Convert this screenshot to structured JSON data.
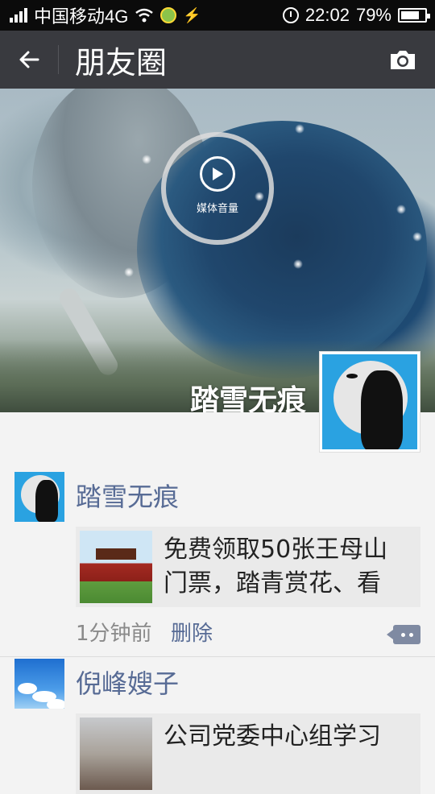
{
  "status_bar": {
    "carrier": "中国移动4G",
    "time": "22:02",
    "battery": "79%",
    "battery_level": 0.79
  },
  "header": {
    "title": "朋友圈"
  },
  "cover": {
    "media_label": "媒体音量",
    "user_name": "踏雪无痕"
  },
  "feed": [
    {
      "name": "踏雪无痕",
      "card_text": "免费领取50张王母山门票，踏青赏花、看",
      "time": "1分钟前",
      "delete": "删除"
    },
    {
      "name": "倪峰嫂子",
      "card_text": "公司党委中心组学习"
    }
  ]
}
